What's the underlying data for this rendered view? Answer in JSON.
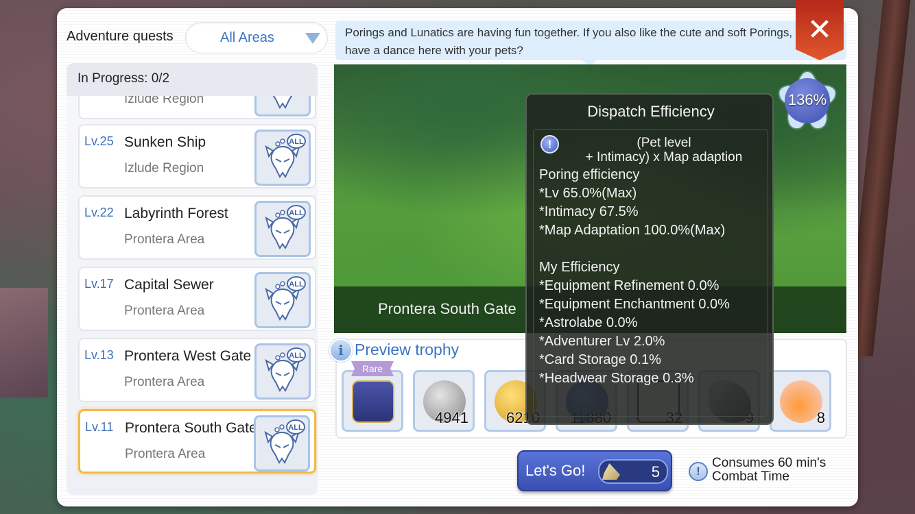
{
  "header": {
    "title": "Adventure quests",
    "area_filter": {
      "selected": "All Areas"
    }
  },
  "quest_list": {
    "progress_label": "In Progress: 0/2",
    "partial_top_region": "Izlude Region",
    "quests": [
      {
        "level": "Lv.25",
        "name": "Sunken Ship",
        "region": "Izlude Region",
        "selected": false,
        "monster_icon": "monster-skull-all-icon"
      },
      {
        "level": "Lv.22",
        "name": "Labyrinth Forest",
        "region": "Prontera Area",
        "selected": false,
        "monster_icon": "monster-skull-all-icon"
      },
      {
        "level": "Lv.17",
        "name": "Capital Sewer",
        "region": "Prontera Area",
        "selected": false,
        "monster_icon": "monster-skull-all-icon"
      },
      {
        "level": "Lv.13",
        "name": "Prontera West Gate",
        "region": "Prontera Area",
        "selected": false,
        "monster_icon": "monster-skull-all-icon"
      },
      {
        "level": "Lv.11",
        "name": "Prontera South Gate",
        "region": "Prontera Area",
        "selected": true,
        "monster_icon": "monster-skull-all-icon"
      }
    ],
    "monster_badge": "ALL"
  },
  "detail": {
    "description": "Porings and Lunatics are having fun together. If you also like the cute and soft Porings, why not have a dance here with your pets?",
    "map_name": "Prontera South Gate",
    "efficiency_badge": "136%",
    "close_icon": "close-icon"
  },
  "tooltip": {
    "title": "Dispatch Efficiency",
    "formula_line1": "(Pet level",
    "formula_line2": "+ Intimacy) x Map adaption",
    "lines": [
      "Poring efficiency",
      "*Lv 65.0%(Max)",
      "*Intimacy 67.5%",
      "*Map Adaptation 100.0%(Max)",
      "",
      "My Efficiency",
      "*Equipment Refinement 0.0%",
      "*Equipment Enchantment 0.0%",
      "*Astrolabe 0.0%",
      "*Adventurer Lv 2.0%",
      "*Card Storage 0.1%",
      "*Headwear Storage 0.3%"
    ]
  },
  "trophy": {
    "title": "Preview trophy",
    "rare_label": "Rare",
    "items": [
      {
        "icon": "treasure-chest-icon",
        "count": "",
        "rare": true
      },
      {
        "icon": "zeny-coin-icon",
        "count": "4941"
      },
      {
        "icon": "job-exp-coin-icon",
        "count": "6210"
      },
      {
        "icon": "base-exp-coin-icon",
        "count": "11880"
      },
      {
        "icon": "material-cloth-icon",
        "count": "32"
      },
      {
        "icon": "material-feather-icon",
        "count": "9"
      },
      {
        "icon": "apple-juice-icon",
        "count": "8"
      }
    ]
  },
  "action": {
    "go_label": "Let's Go!",
    "cost": "5",
    "cost_icon": "stone-gem-icon",
    "consume_line1": "Consumes 60 min's",
    "consume_line2": "Combat Time"
  },
  "colors": {
    "accent_blue": "#3d74c4",
    "selected_border": "#f2b94a",
    "close_red": "#d8452a",
    "go_button": "#4a62c6"
  }
}
